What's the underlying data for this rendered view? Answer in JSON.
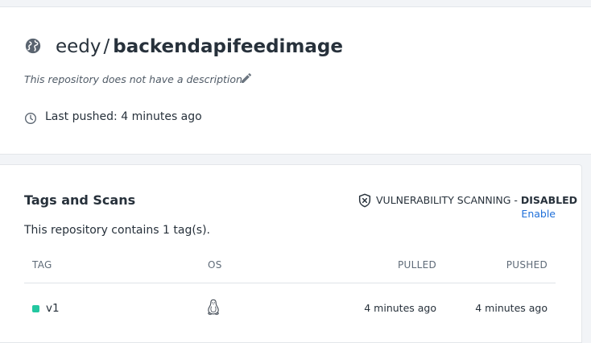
{
  "repo": {
    "namespace": "eedy",
    "separator": "/",
    "name": "backendapifeedimage",
    "description": "This repository does not have a description",
    "last_pushed": "Last pushed: 4 minutes ago",
    "visibility_icon": "globe-icon"
  },
  "tags_section": {
    "title": "Tags and Scans",
    "scanning_label": "VULNERABILITY SCANNING - ",
    "scanning_state": "DISABLED",
    "enable_label": "Enable",
    "count_text": "This repository contains 1 tag(s).",
    "columns": [
      "TAG",
      "OS",
      "PULLED",
      "PUSHED"
    ],
    "rows": [
      {
        "tag": "v1",
        "os": "linux-icon",
        "pulled": "4 minutes ago",
        "pushed": "4 minutes ago",
        "status_color": "#23c7a0"
      }
    ]
  },
  "colors": {
    "accent_link": "#1e6fd9",
    "status_active": "#23c7a0"
  }
}
